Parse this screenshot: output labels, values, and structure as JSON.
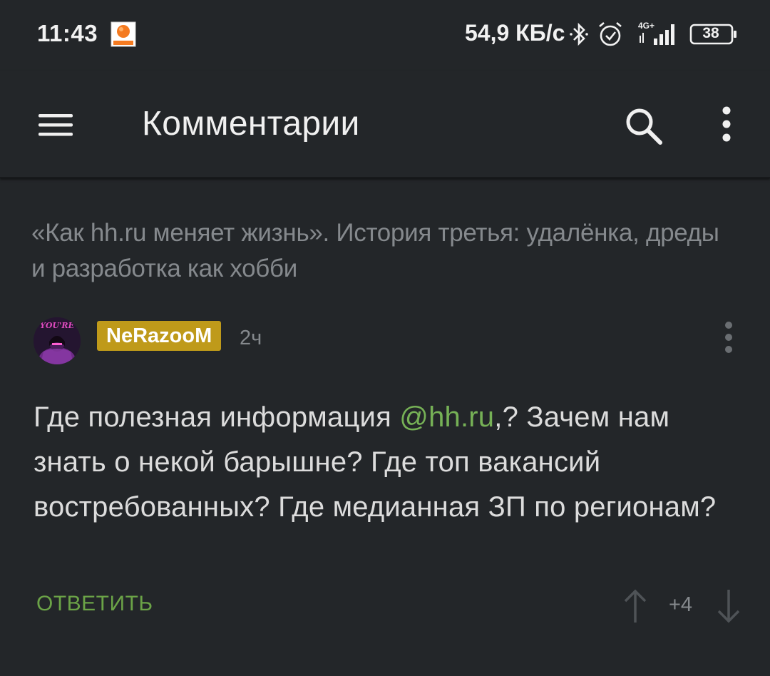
{
  "status_bar": {
    "time": "11:43",
    "network_speed": "54,9 КБ/с",
    "network_type": "4G+",
    "battery": "38",
    "icons": [
      "notification-app-icon",
      "bluetooth-icon",
      "alarm-icon",
      "signal-icon",
      "battery-icon"
    ]
  },
  "app_bar": {
    "title": "Комментарии",
    "icons": [
      "hamburger-menu-icon",
      "search-icon",
      "more-vertical-icon"
    ]
  },
  "post": {
    "title": "«Как hh.ru меняет жизнь». История третья: удалёнка, дреды и разработка как хобби"
  },
  "comment": {
    "author": "NeRazooM",
    "time_ago": "2ч",
    "avatar_text": "YOU'RE",
    "text_before": "Где полезная информация ",
    "mention": "@hh.ru",
    "text_after": ",? Зачем нам знать о некой барышне? Где топ вакансий востребованных? Где медианная ЗП по регионам?",
    "reply_label": "ОТВЕТИТЬ",
    "rating": "+4"
  },
  "colors": {
    "background": "#232629",
    "accent_green": "#6ba347",
    "badge_gold": "#bf9a1a",
    "muted_text": "#85898d"
  }
}
